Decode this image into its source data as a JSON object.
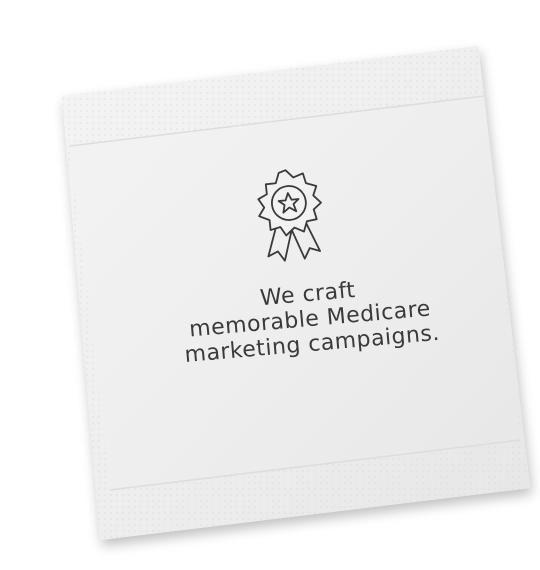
{
  "napkin": {
    "badge_icon": "award-ribbon-star-icon",
    "message_lines": [
      "We craft",
      "memorable Medicare",
      "marketing campaigns."
    ]
  },
  "colors": {
    "background": "#ffffff",
    "napkin": "#f2f2f2",
    "ink": "#3a3a3a"
  }
}
